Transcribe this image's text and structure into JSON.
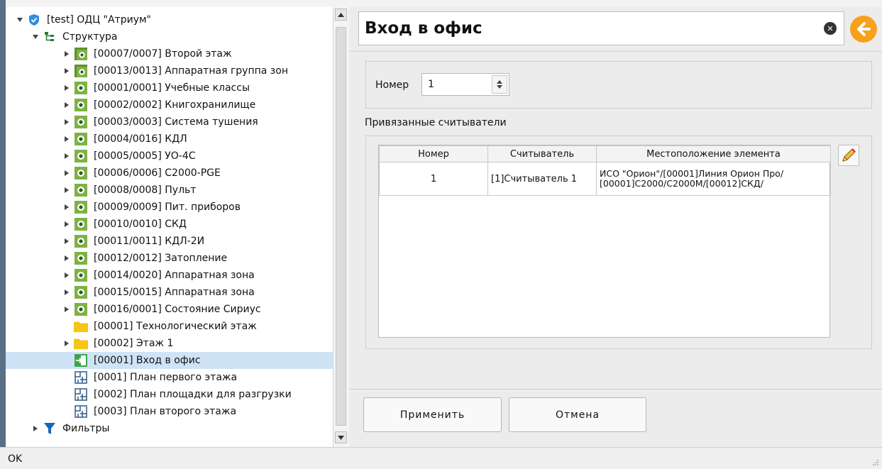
{
  "tree": {
    "items": [
      {
        "label": "[test] ОДЦ \"Атриум\"",
        "arrow": "down",
        "icon": "shield-icon"
      },
      {
        "label": "Структура",
        "arrow": "down",
        "icon": "structure-icon"
      },
      {
        "label": "[00007/0007] Второй этаж",
        "arrow": "right",
        "icon": "zone-group-icon"
      },
      {
        "label": "[00013/0013] Аппаратная группа зон",
        "arrow": "right",
        "icon": "zone-group-icon"
      },
      {
        "label": "[00001/0001] Учебные классы",
        "arrow": "right",
        "icon": "zone-icon"
      },
      {
        "label": "[00002/0002] Книгохранилище",
        "arrow": "right",
        "icon": "zone-icon"
      },
      {
        "label": "[00003/0003] Система тушения",
        "arrow": "right",
        "icon": "zone-icon"
      },
      {
        "label": "[00004/0016] КДЛ",
        "arrow": "right",
        "icon": "zone-icon"
      },
      {
        "label": "[00005/0005] УО-4С",
        "arrow": "right",
        "icon": "zone-icon"
      },
      {
        "label": "[00006/0006] С2000-PGE",
        "arrow": "right",
        "icon": "zone-icon"
      },
      {
        "label": "[00008/0008] Пульт",
        "arrow": "right",
        "icon": "zone-icon"
      },
      {
        "label": "[00009/0009] Пит. приборов",
        "arrow": "right",
        "icon": "zone-icon"
      },
      {
        "label": "[00010/0010] СКД",
        "arrow": "right",
        "icon": "zone-icon"
      },
      {
        "label": "[00011/0011] КДЛ-2И",
        "arrow": "right",
        "icon": "zone-icon"
      },
      {
        "label": "[00012/0012] Затопление",
        "arrow": "right",
        "icon": "zone-icon"
      },
      {
        "label": "[00014/0020] Аппаратная зона",
        "arrow": "right",
        "icon": "zone-icon"
      },
      {
        "label": "[00015/0015] Аппаратная зона",
        "arrow": "right",
        "icon": "zone-icon"
      },
      {
        "label": "[00016/0001] Состояние Сириус",
        "arrow": "right",
        "icon": "zone-icon"
      },
      {
        "label": "[00001] Технологический этаж",
        "arrow": "none",
        "icon": "folder-icon"
      },
      {
        "label": "[00002] Этаж 1",
        "arrow": "right",
        "icon": "folder-icon"
      },
      {
        "label": "[00001] Вход в офис",
        "arrow": "none",
        "icon": "entrance-icon",
        "selected": true
      },
      {
        "label": "[0001] План первого этажа",
        "arrow": "none",
        "icon": "floor-plan-icon"
      },
      {
        "label": "[0002] План площадки для разгрузки",
        "arrow": "none",
        "icon": "floor-plan-icon"
      },
      {
        "label": "[0003] План второго этажа",
        "arrow": "none",
        "icon": "floor-plan-icon"
      },
      {
        "label": "Фильтры",
        "arrow": "right",
        "icon": "filter-icon"
      }
    ]
  },
  "header": {
    "title": "Вход в офис"
  },
  "form": {
    "nomer_label": "Номер",
    "nomer_value": "1",
    "readers_caption": "Привязанные считыватели"
  },
  "table": {
    "columns": [
      "Номер",
      "Считыватель",
      "Местоположение элемента"
    ],
    "rows": [
      {
        "number": "1",
        "reader": "[1]Считыватель 1",
        "location": "ИСО \"Орион\"/[00001]Линия Орион Про/\n[00001]С2000/С2000М/[00012]СКД/"
      }
    ]
  },
  "buttons": {
    "apply": "Применить",
    "cancel": "Отмена"
  },
  "status": {
    "text": "OK"
  },
  "colors": {
    "accent": "#f7a01a",
    "selection": "#cfe3f7",
    "zone_green": "#7cb342",
    "folder": "#f6c518"
  }
}
